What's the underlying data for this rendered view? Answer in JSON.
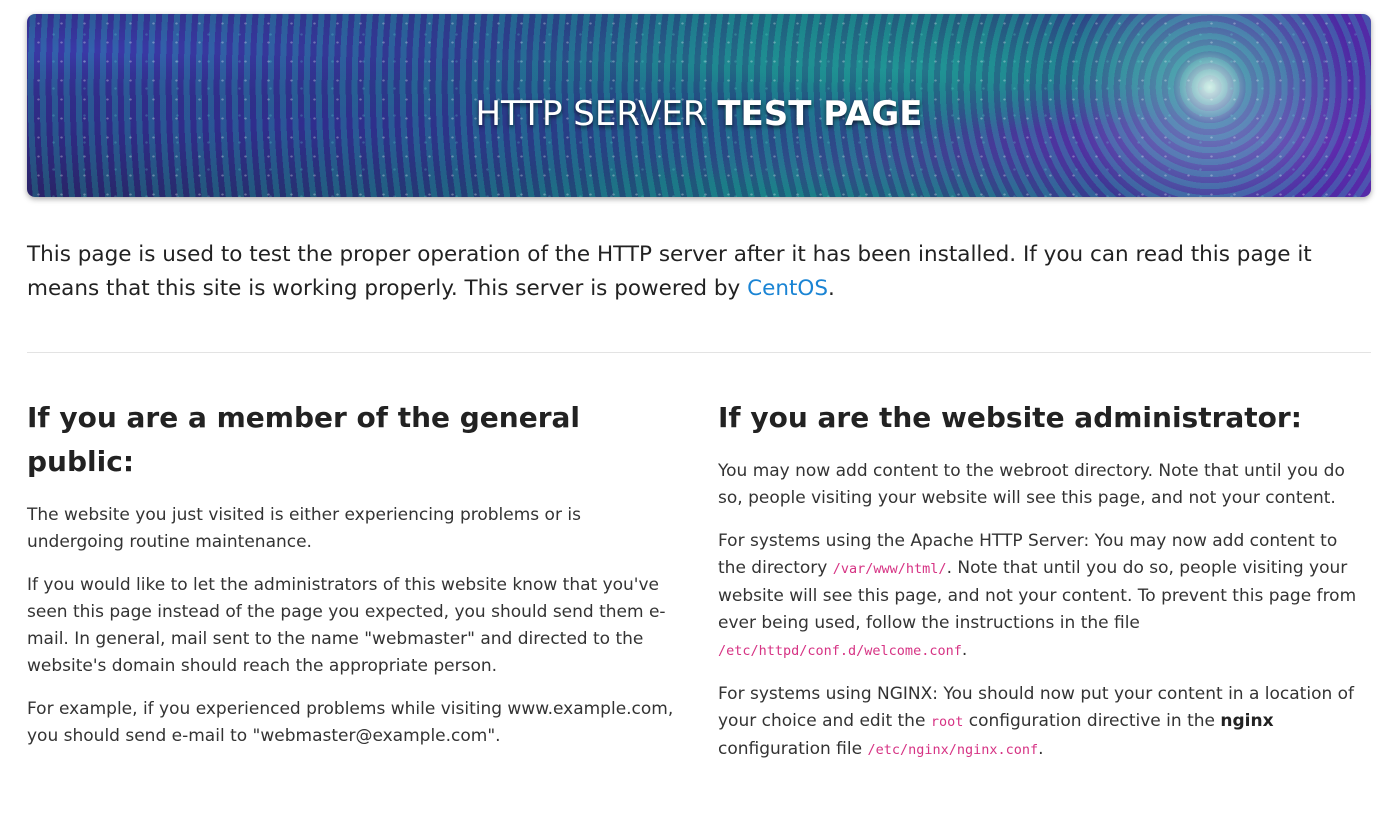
{
  "banner": {
    "title_light": "HTTP SERVER ",
    "title_bold": "TEST PAGE"
  },
  "intro": {
    "text": "This page is used to test the proper operation of the HTTP server after it has been installed. If you can read this page it means that this site is working properly. This server is powered by ",
    "link_text": "CentOS",
    "trailing": "."
  },
  "public_section": {
    "heading": "If you are a member of the general public:",
    "p1": "The website you just visited is either experiencing problems or is undergoing routine maintenance.",
    "p2": "If you would like to let the administrators of this website know that you've seen this page instead of the page you expected, you should send them e-mail. In general, mail sent to the name \"webmaster\" and directed to the website's domain should reach the appropriate person.",
    "p3": "For example, if you experienced problems while visiting www.example.com, you should send e-mail to \"webmaster@example.com\"."
  },
  "admin_section": {
    "heading": "If you are the website administrator:",
    "p1": "You may now add content to the webroot directory. Note that until you do so, people visiting your website will see this page, and not your content.",
    "p2_a": "For systems using the Apache HTTP Server: You may now add content to the directory ",
    "p2_code1": "/var/www/html/",
    "p2_b": ". Note that until you do so, people visiting your website will see this page, and not your content. To prevent this page from ever being used, follow the instructions in the file ",
    "p2_code2": "/etc/httpd/conf.d/welcome.conf",
    "p2_c": ".",
    "p3_a": "For systems using NGINX: You should now put your content in a location of your choice and edit the ",
    "p3_code1": "root",
    "p3_b": " configuration directive in the ",
    "p3_bold": "nginx",
    "p3_c": " configuration file ",
    "p3_code2": "/etc/nginx/nginx.conf",
    "p3_d": "."
  },
  "colors": {
    "link": "#1a84d4",
    "code": "#d63384"
  }
}
